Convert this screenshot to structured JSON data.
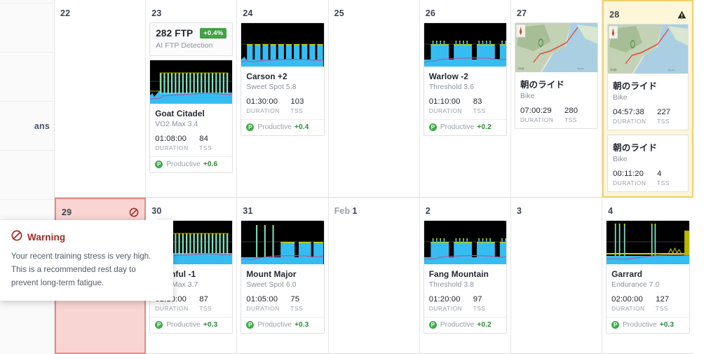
{
  "sidebar": {
    "label": "ans",
    "chevron_icon": "chevron-right-icon"
  },
  "warning_tooltip": {
    "icon": "no-entry-icon",
    "title": "Warning",
    "line1": "Your recent training stress is very high.",
    "line2": "This is a recommended rest day to",
    "line3": "prevent long-term fatigue."
  },
  "colors": {
    "badge_green": "#43a047",
    "productive_green": "#2e8b3a",
    "warning_bg": "#fdf6d9",
    "warning_border": "#f2d06b",
    "rest_bg": "#f8d4d2",
    "rest_border": "#e08b86",
    "graph_bg": "#000000",
    "graph_power": "#35bdf2",
    "graph_interval": "#7ee0c0",
    "graph_outline": "#c8d400",
    "graph_hr": "#a45fa8"
  },
  "labels": {
    "duration": "DURATION",
    "tss": "TSS",
    "productive": "Productive"
  },
  "row1": [
    {
      "day": "22",
      "month": "",
      "state": "normal",
      "cards": []
    },
    {
      "day": "23",
      "month": "",
      "state": "normal",
      "ftp": {
        "value": "282 FTP",
        "badge": "+0.4%",
        "sub": "AI FTP Detection"
      },
      "cards": [
        {
          "thumb": "graph-interval-dense",
          "title": "Goat Citadel",
          "sub": "VO2 Max 3.4",
          "duration": "01:08:00",
          "tss": "84",
          "footer": "Productive",
          "delta": "+0.6"
        }
      ]
    },
    {
      "day": "24",
      "month": "",
      "state": "normal",
      "cards": [
        {
          "thumb": "graph-sweetspot",
          "title": "Carson +2",
          "sub": "Sweet Spot 5.8",
          "duration": "01:30:00",
          "tss": "103",
          "footer": "Productive",
          "delta": "+0.4"
        }
      ]
    },
    {
      "day": "25",
      "month": "",
      "state": "normal",
      "cards": []
    },
    {
      "day": "26",
      "month": "",
      "state": "normal",
      "cards": [
        {
          "thumb": "graph-threshold",
          "title": "Warlow -2",
          "sub": "Threshold 3.6",
          "duration": "01:10:00",
          "tss": "83",
          "footer": "Productive",
          "delta": "+0.2"
        }
      ]
    },
    {
      "day": "27",
      "month": "",
      "state": "normal",
      "cards": [
        {
          "thumb": "map-route",
          "title": "朝のライド",
          "sub": "Bike",
          "duration": "07:00:29",
          "tss": "280",
          "footer": "",
          "delta": ""
        }
      ]
    },
    {
      "day": "28",
      "month": "",
      "state": "warning",
      "icon": "warning-triangle-icon",
      "cards": [
        {
          "thumb": "map-route",
          "title": "朝のライド",
          "sub": "Bike",
          "duration": "04:57:38",
          "tss": "227",
          "footer": "",
          "delta": ""
        },
        {
          "thumb": "",
          "title": "朝のライド",
          "sub": "Bike",
          "duration": "00:11:20",
          "tss": "4",
          "footer": "",
          "delta": ""
        }
      ]
    }
  ],
  "row2": [
    {
      "day": "29",
      "month": "",
      "state": "rest",
      "icon": "no-entry-icon",
      "cards": []
    },
    {
      "day": "30",
      "month": "",
      "state": "normal",
      "cards": [
        {
          "thumb": "graph-interval-dense",
          "title": "Bashful -1",
          "sub": "VO2 Max 3.7",
          "duration": "01:10:00",
          "tss": "87",
          "footer": "Productive",
          "delta": "+0.3"
        }
      ]
    },
    {
      "day": "31",
      "month": "",
      "state": "normal",
      "cards": [
        {
          "thumb": "graph-spikes",
          "title": "Mount Major",
          "sub": "Sweet Spot 6.0",
          "duration": "01:05:00",
          "tss": "75",
          "footer": "Productive",
          "delta": "+0.3"
        }
      ]
    },
    {
      "day": "1",
      "month": "Feb",
      "state": "normal",
      "cards": []
    },
    {
      "day": "2",
      "month": "",
      "state": "normal",
      "cards": [
        {
          "thumb": "graph-threshold",
          "title": "Fang Mountain",
          "sub": "Threshold 3.8",
          "duration": "01:20:00",
          "tss": "97",
          "footer": "Productive",
          "delta": "+0.2"
        }
      ]
    },
    {
      "day": "3",
      "month": "",
      "state": "normal",
      "cards": []
    },
    {
      "day": "4",
      "month": "",
      "state": "normal",
      "cards": [
        {
          "thumb": "graph-endurance",
          "title": "Garrard",
          "sub": "Endurance 7.0",
          "duration": "02:00:00",
          "tss": "127",
          "footer": "Productive",
          "delta": "+0.3"
        }
      ]
    }
  ]
}
